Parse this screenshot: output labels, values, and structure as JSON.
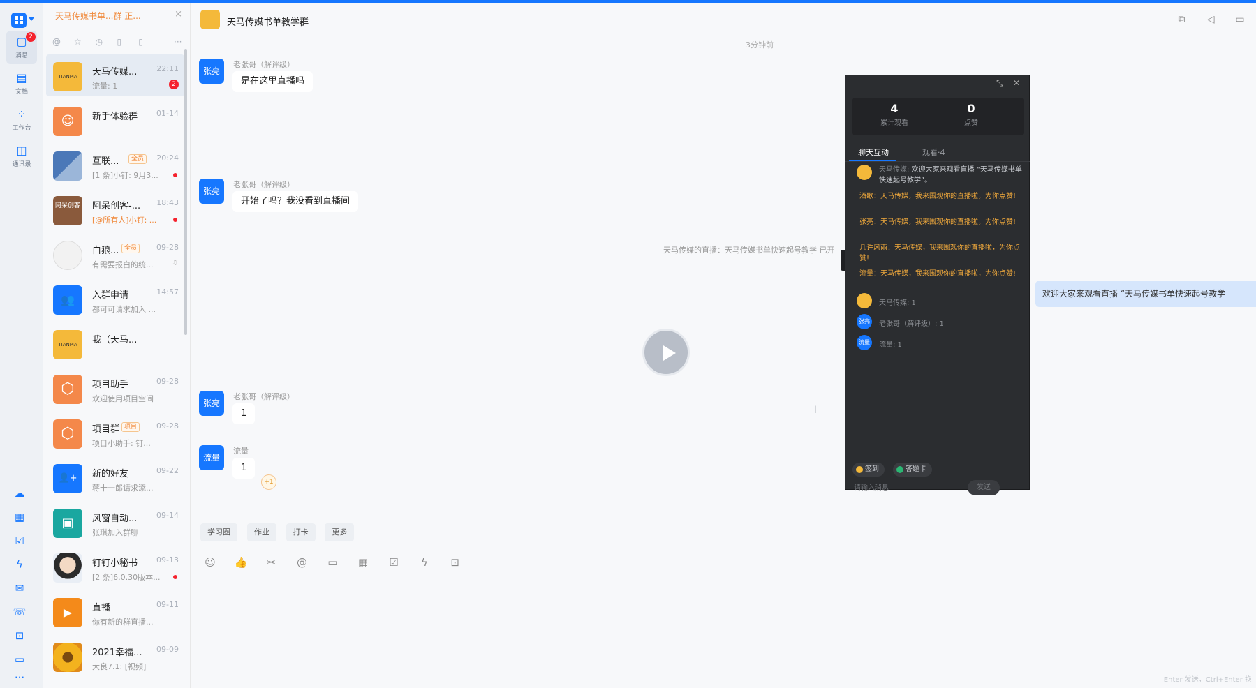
{
  "rail": {
    "badge": "2",
    "items": [
      {
        "label": "消息",
        "icon": "message-icon"
      },
      {
        "label": "文档",
        "icon": "document-icon"
      },
      {
        "label": "工作台",
        "icon": "workbench-icon"
      },
      {
        "label": "通讯录",
        "icon": "contacts-icon"
      }
    ],
    "more": "···"
  },
  "tabbar": {
    "title": "天马传媒书单...群 正...",
    "close": "×"
  },
  "conversations": [
    {
      "name": "天马传媒...",
      "time": "22:11",
      "preview": "流量: 1",
      "unread": "2",
      "avatar": "TIANMA",
      "avatar_color": "#f4b93a"
    },
    {
      "name": "新手体验群",
      "time": "01-14",
      "preview": "",
      "avatar": "☺",
      "avatar_color": "#f4884a"
    },
    {
      "name": "互联...",
      "tag": "全员",
      "time": "20:24",
      "preview": "[1 条]小钉: 9月3...",
      "avatar": "",
      "avatar_color": "#4b78b8"
    },
    {
      "name": "阿呆创客-...",
      "time": "18:43",
      "preview": "[@所有人]小钉: ...",
      "avatar": "阿呆创客",
      "avatar_color": "#8a5a3c"
    },
    {
      "name": "白狼...",
      "tag": "全员",
      "time": "09-28",
      "preview": "有需要报白的统...",
      "avatar": "",
      "avatar_color": "#f2f2f2"
    },
    {
      "name": "入群申请",
      "time": "14:57",
      "preview": "都可可请求加入 ...",
      "avatar": "👥",
      "avatar_color": "#1677ff"
    },
    {
      "name": "我（天马...",
      "time": "",
      "preview": "",
      "avatar": "TIANMA",
      "avatar_color": "#f4b93a"
    },
    {
      "name": "项目助手",
      "time": "09-28",
      "preview": "欢迎使用项目空间",
      "avatar": "⬡",
      "avatar_color": "#f4884a"
    },
    {
      "name": "项目群",
      "tag": "项目",
      "time": "09-28",
      "preview": "项目小助手: 钉...",
      "avatar": "⬡",
      "avatar_color": "#f4884a"
    },
    {
      "name": "新的好友",
      "time": "09-22",
      "preview": "蒋十一郎请求添...",
      "avatar": "👤+",
      "avatar_color": "#1677ff"
    },
    {
      "name": "风窗自动...",
      "time": "09-14",
      "preview": "张琪加入群聊",
      "avatar": "▣",
      "avatar_color": "#1aa7a0"
    },
    {
      "name": "钉钉小秘书",
      "time": "09-13",
      "preview": "[2 条]6.0.30版本...",
      "avatar": "",
      "avatar_color": "#d9c0a8"
    },
    {
      "name": "直播",
      "time": "09-11",
      "preview": "你有新的群直播...",
      "avatar": "▶",
      "avatar_color": "#f48a1a"
    },
    {
      "name": "2021幸福...",
      "time": "09-09",
      "preview": "大良7.1: [视频]",
      "avatar": "",
      "avatar_color": "#e8a21a"
    }
  ],
  "chat": {
    "title": "天马传媒书单教学群",
    "time_separator": "3分钟前",
    "messages": [
      {
        "avatar": "张亮",
        "sender": "老张哥（解评级）",
        "text": "是在这里直播吗"
      },
      {
        "avatar": "张亮",
        "sender": "老张哥（解评级）",
        "text": "开始了吗？我没看到直播间"
      },
      {
        "avatar": "张亮",
        "sender": "老张哥（解评级）",
        "text": "1"
      },
      {
        "avatar": "流量",
        "sender": "流量",
        "text": "1"
      }
    ],
    "plus_one": "+1",
    "system_line": "天马传媒的直播：天马传媒书单快速起号教学 已开",
    "right_bubble": "欢迎大家来观看直播 “天马传媒书单快速起号教学",
    "quick_actions": [
      "学习圈",
      "作业",
      "打卡",
      "更多"
    ],
    "hint": "Enter 发送，Ctrl+Enter 换"
  },
  "live": {
    "total_views": "4",
    "total_views_label": "累计观看",
    "likes": "0",
    "likes_label": "点赞",
    "tabs": [
      "聊天互动",
      "观看·4"
    ],
    "welcome_sender": "天马传媒:",
    "welcome_text": "欢迎大家来观看直播 “天马传媒书单快速起号教学”。",
    "orange_lines": [
      "酒歌：天马传媒，我来围观你的直播啦，为你点赞!",
      "张亮：天马传媒，我来围观你的直播啦，为你点赞!",
      "几许风雨：天马传媒，我来围观你的直播啦，为你点赞!",
      "流量：天马传媒，我来围观你的直播啦，为你点赞!"
    ],
    "counts": [
      {
        "avatar": "",
        "text": "天马传媒: 1"
      },
      {
        "avatar": "张亮",
        "text": "老张哥（解评级）: 1"
      },
      {
        "avatar": "流量",
        "text": "流量: 1"
      }
    ],
    "chip_signin": "签到",
    "chip_card": "答题卡",
    "input_placeholder": "请输入消息",
    "send": "发送"
  }
}
